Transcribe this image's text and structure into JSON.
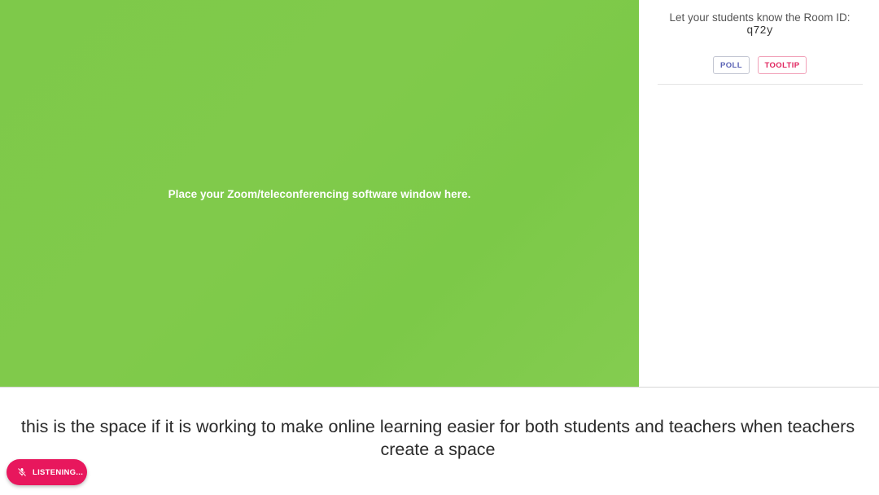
{
  "stage": {
    "placeholder_text": "Place your Zoom/teleconferencing software window here.",
    "background_color": "#80ca4b"
  },
  "side_panel": {
    "room_label": "Let your students know the Room ID:",
    "room_id": "q72y",
    "poll_label": "POLL",
    "tooltip_label": "TOOLTIP"
  },
  "caption": {
    "text": "this is the space if it is working to make online learning easier for both students and teachers when teachers create a space"
  },
  "listening_button": {
    "label": "LISTENING...",
    "icon": "mic-off-icon",
    "color": "#e8175d"
  },
  "colors": {
    "accent_pink": "#e0245e",
    "accent_indigo": "#5b63b5"
  }
}
